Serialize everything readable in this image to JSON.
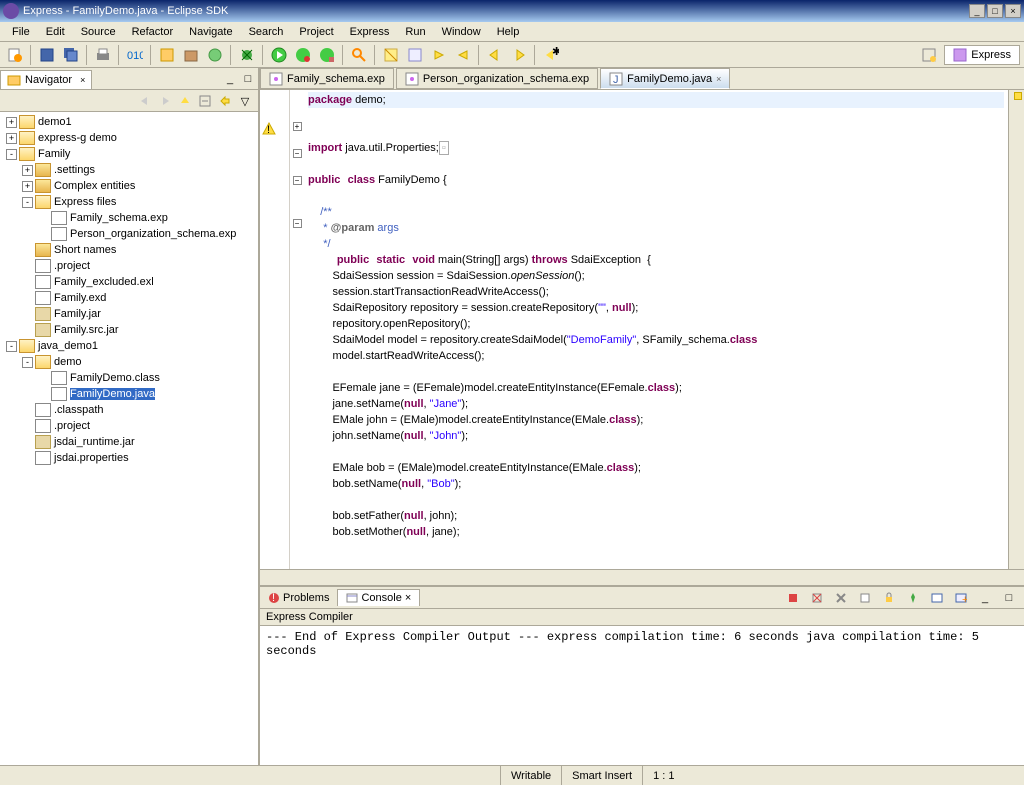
{
  "window": {
    "title": "Express - FamilyDemo.java - Eclipse SDK"
  },
  "menus": [
    "File",
    "Edit",
    "Source",
    "Refactor",
    "Navigate",
    "Search",
    "Project",
    "Express",
    "Run",
    "Window",
    "Help"
  ],
  "perspective": {
    "label": "Express"
  },
  "navigator": {
    "title": "Navigator",
    "tree": [
      {
        "level": 0,
        "exp": "+",
        "icon": "folder-open",
        "label": "demo1"
      },
      {
        "level": 0,
        "exp": "+",
        "icon": "folder-open",
        "label": "express-g demo"
      },
      {
        "level": 0,
        "exp": "-",
        "icon": "folder-open",
        "label": "Family"
      },
      {
        "level": 1,
        "exp": "+",
        "icon": "folder-icon",
        "label": ".settings"
      },
      {
        "level": 1,
        "exp": "+",
        "icon": "folder-icon",
        "label": "Complex entities"
      },
      {
        "level": 1,
        "exp": "-",
        "icon": "folder-open",
        "label": "Express files"
      },
      {
        "level": 2,
        "exp": "",
        "icon": "file-icon",
        "label": "Family_schema.exp"
      },
      {
        "level": 2,
        "exp": "",
        "icon": "file-icon",
        "label": "Person_organization_schema.exp"
      },
      {
        "level": 1,
        "exp": "",
        "icon": "folder-icon",
        "label": "Short names"
      },
      {
        "level": 1,
        "exp": "",
        "icon": "file-icon",
        "label": ".project"
      },
      {
        "level": 1,
        "exp": "",
        "icon": "file-icon",
        "label": "Family_excluded.exl"
      },
      {
        "level": 1,
        "exp": "",
        "icon": "file-icon",
        "label": "Family.exd"
      },
      {
        "level": 1,
        "exp": "",
        "icon": "jar-icon",
        "label": "Family.jar"
      },
      {
        "level": 1,
        "exp": "",
        "icon": "jar-icon",
        "label": "Family.src.jar"
      },
      {
        "level": 0,
        "exp": "-",
        "icon": "folder-open",
        "label": "java_demo1"
      },
      {
        "level": 1,
        "exp": "-",
        "icon": "folder-open",
        "label": "demo"
      },
      {
        "level": 2,
        "exp": "",
        "icon": "file-icon",
        "label": "FamilyDemo.class"
      },
      {
        "level": 2,
        "exp": "",
        "icon": "java-icon",
        "label": "FamilyDemo.java",
        "selected": true
      },
      {
        "level": 1,
        "exp": "",
        "icon": "file-icon",
        "label": ".classpath"
      },
      {
        "level": 1,
        "exp": "",
        "icon": "file-icon",
        "label": ".project"
      },
      {
        "level": 1,
        "exp": "",
        "icon": "jar-icon",
        "label": "jsdai_runtime.jar"
      },
      {
        "level": 1,
        "exp": "",
        "icon": "file-icon",
        "label": "jsdai.properties"
      }
    ]
  },
  "editor_tabs": [
    {
      "label": "Family_schema.exp",
      "icon": "file",
      "active": false
    },
    {
      "label": "Person_organization_schema.exp",
      "icon": "file",
      "active": false
    },
    {
      "label": "FamilyDemo.java",
      "icon": "java",
      "active": true
    }
  ],
  "code": {
    "l1_kw": "package",
    "l1_rest": " demo;",
    "l3_kw": "import",
    "l3_rest": " java.util.Properties;",
    "l5a": "public",
    "l5b": "class",
    "l5c": " FamilyDemo {",
    "doc1": "    /**",
    "doc2_a": "     * ",
    "doc2_b": "@param",
    "doc2_c": " args",
    "doc3": "     */",
    "m_a": "public",
    "m_b": "static",
    "m_c": "void",
    "m_d": " main(String[] args) ",
    "m_e": "throws",
    "m_f": " SdaiException  {",
    "b1_a": "        SdaiSession session = SdaiSession.",
    "b1_b": "openSession",
    "b1_c": "();",
    "b2": "        session.startTransactionReadWriteAccess();",
    "b3_a": "        SdaiRepository repository = session.createRepository(",
    "b3_b": "\"\"",
    "b3_c": ", ",
    "b3_d": "null",
    "b3_e": ");",
    "b4": "        repository.openRepository();",
    "b5_a": "        SdaiModel model = repository.createSdaiModel(",
    "b5_b": "\"DemoFamily\"",
    "b5_c": ", SFamily_schema.",
    "b5_d": "class",
    "b6": "        model.startReadWriteAccess();",
    "b8_a": "        EFemale jane = (EFemale)model.createEntityInstance(EFemale.",
    "b8_b": "class",
    "b8_c": ");",
    "b9_a": "        jane.setName(",
    "b9_b": "null",
    "b9_c": ", ",
    "b9_d": "\"Jane\"",
    "b9_e": ");",
    "b10_a": "        EMale john = (EMale)model.createEntityInstance(EMale.",
    "b10_b": "class",
    "b10_c": ");",
    "b11_a": "        john.setName(",
    "b11_b": "null",
    "b11_c": ", ",
    "b11_d": "\"John\"",
    "b11_e": ");",
    "b13_a": "        EMale bob = (EMale)model.createEntityInstance(EMale.",
    "b13_b": "class",
    "b13_c": ");",
    "b14_a": "        bob.setName(",
    "b14_b": "null",
    "b14_c": ", ",
    "b14_d": "\"Bob\"",
    "b14_e": ");",
    "b16_a": "        bob.setFather(",
    "b16_b": "null",
    "b16_c": ", john);",
    "b17_a": "        bob.setMother(",
    "b17_b": "null",
    "b17_c": ", jane);"
  },
  "bottom": {
    "tabs": [
      "Problems",
      "Console"
    ],
    "active_tab": 1,
    "console_title": "Express Compiler",
    "lines": [
      "",
      "--- End of Express Compiler Output ---",
      "express compilation time: 6 seconds",
      "java compilation time: 5 seconds"
    ]
  },
  "status": {
    "writable": "Writable",
    "insert": "Smart Insert",
    "pos": "1 : 1"
  }
}
